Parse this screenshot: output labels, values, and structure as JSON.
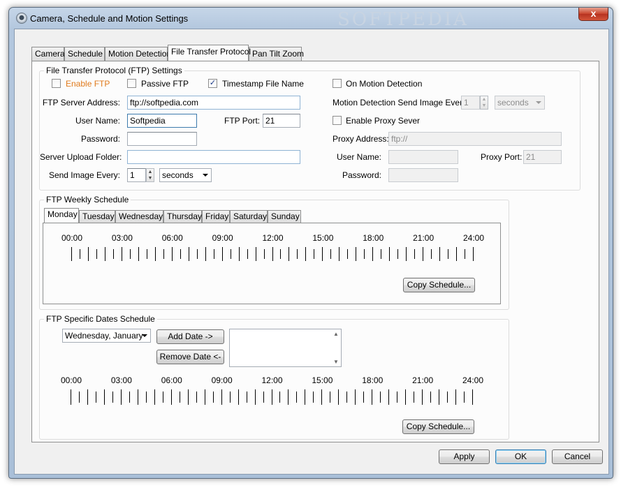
{
  "window": {
    "title": "Camera, Schedule and Motion Settings",
    "close_glyph": "x",
    "watermark": "SOFTPEDIA"
  },
  "tabs": [
    {
      "label": "Camera"
    },
    {
      "label": "Schedule"
    },
    {
      "label": "Motion Detection"
    },
    {
      "label": "File Transfer Protocol",
      "active": true
    },
    {
      "label": "Pan Tilt Zoom"
    }
  ],
  "ftp": {
    "group_title": "File Transfer Protocol (FTP) Settings",
    "enable_ftp": {
      "label": "Enable FTP",
      "checked": false
    },
    "passive_ftp": {
      "label": "Passive FTP",
      "checked": false
    },
    "timestamp": {
      "label": "Timestamp File Name",
      "checked": true,
      "glyph": "✓"
    },
    "server_address": {
      "label": "FTP Server Address:",
      "value": "ftp://softpedia.com"
    },
    "user_name": {
      "label": "User Name:",
      "value": "Softpedia"
    },
    "port": {
      "label": "FTP Port:",
      "value": "21"
    },
    "password": {
      "label": "Password:",
      "value": ""
    },
    "upload_folder": {
      "label": "Server Upload Folder:",
      "value": ""
    },
    "send_every": {
      "label": "Send Image Every:",
      "value": "1",
      "unit": "seconds"
    },
    "motion": {
      "on_motion": {
        "label": "On Motion Detection",
        "checked": false
      },
      "send_every": {
        "label": "Motion Detection Send Image Every:",
        "value": "1",
        "unit": "seconds"
      }
    },
    "proxy": {
      "enable": {
        "label": "Enable Proxy Sever",
        "checked": false
      },
      "address": {
        "label": "Proxy Address:",
        "value": "ftp://"
      },
      "user_name": {
        "label": "User Name:",
        "value": ""
      },
      "port": {
        "label": "Proxy Port:",
        "value": "21"
      },
      "password": {
        "label": "Password:",
        "value": ""
      }
    }
  },
  "weekly": {
    "group_title": "FTP Weekly Schedule",
    "days": [
      "Monday",
      "Tuesday",
      "Wednesday",
      "Thursday",
      "Friday",
      "Saturday",
      "Sunday"
    ],
    "active_day": "Monday",
    "times": [
      "00:00",
      "03:00",
      "06:00",
      "09:00",
      "12:00",
      "15:00",
      "18:00",
      "21:00",
      "24:00"
    ],
    "copy_label": "Copy Schedule..."
  },
  "specific": {
    "group_title": "FTP Specific Dates Schedule",
    "date_value": "Wednesday,   January",
    "add_label": "Add Date ->",
    "remove_label": "Remove Date <-",
    "times": [
      "00:00",
      "03:00",
      "06:00",
      "09:00",
      "12:00",
      "15:00",
      "18:00",
      "21:00",
      "24:00"
    ],
    "copy_label": "Copy Schedule..."
  },
  "footer": {
    "apply": "Apply",
    "ok": "OK",
    "cancel": "Cancel"
  },
  "icons": {
    "app": "webcam-icon",
    "spin": "spinner-arrows-icon",
    "dropdown": "chevron-down-icon"
  }
}
